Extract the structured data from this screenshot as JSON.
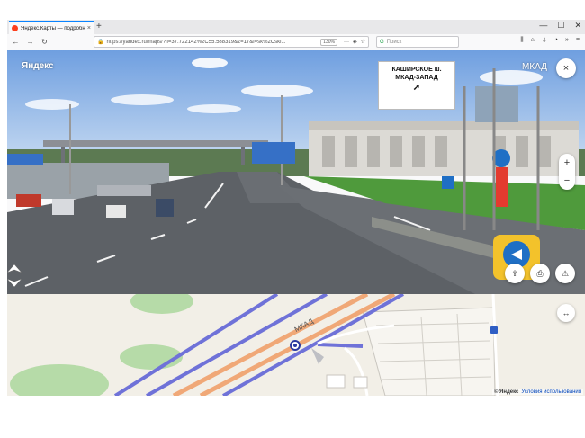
{
  "browser": {
    "tab_title": "Яндекс.Карты — подробная...",
    "tab_close": "×",
    "new_tab": "+",
    "window_controls": [
      "—",
      "☐",
      "✕"
    ],
    "nav": {
      "back": "←",
      "forward": "→",
      "reload": "↻"
    },
    "url": "https://yandex.ru/maps/?ll=37.722142%2C55.588319&z=17&l=sk%2Cskl...",
    "zoom": "130%",
    "url_more": "···",
    "pocket_icon": "pocket-icon",
    "bookmark_icon": "star-icon",
    "search_placeholder": "Поиск",
    "toolbar_icons": [
      "library-icon",
      "home-icon",
      "download-icon",
      "sync-icon",
      "overflow-icon",
      "menu-icon"
    ]
  },
  "panorama": {
    "logo": "Яндекс",
    "title": "МКАД",
    "billboard": {
      "line1": "КАШИРСКОЕ ш.",
      "line2": "МКАД-ЗАПАД",
      "arrow": "➚"
    },
    "close_icon": "×",
    "zoom_in": "+",
    "zoom_out": "−",
    "share_icon": "⇪",
    "print_icon": "⎙",
    "warning_icon": "⚠"
  },
  "map": {
    "road_label": "МКАД",
    "toggle_icon": "↔",
    "copyright_brand": "© Яндекс",
    "copyright_link": "Условия использования"
  },
  "colors": {
    "road_blue": "#6f72d8",
    "road_orange": "#f0a877",
    "map_bg": "#f2efe7",
    "sky": "#8db4e8",
    "tab_accent": "#0a84ff"
  }
}
